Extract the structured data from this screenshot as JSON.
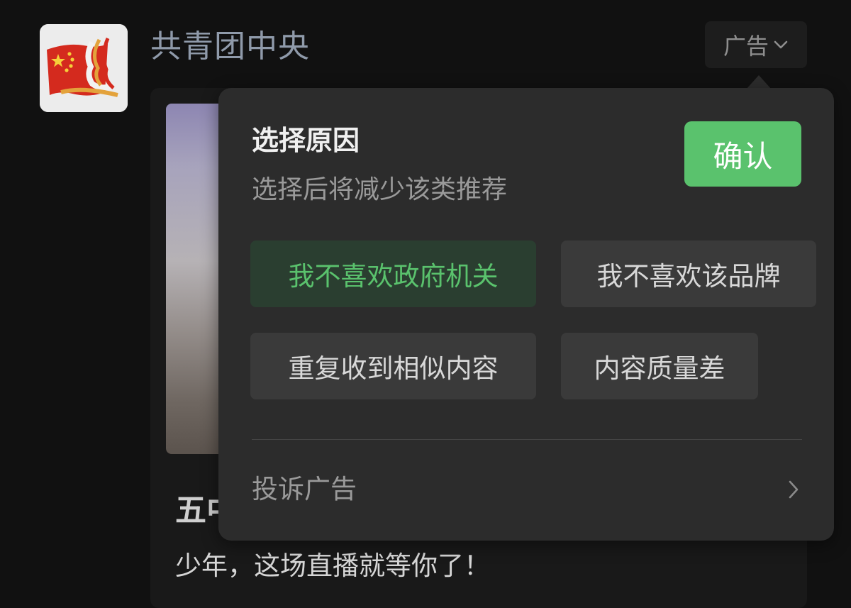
{
  "header": {
    "account_name": "共青团中央",
    "ad_label": "广告"
  },
  "card": {
    "title": "五中",
    "description": "少年，这场直播就等你了！"
  },
  "popup": {
    "title": "选择原因",
    "subtitle": "选择后将减少该类推荐",
    "confirm_label": "确认",
    "reasons": [
      {
        "label": "我不喜欢政府机关",
        "selected": true
      },
      {
        "label": "我不喜欢该品牌",
        "selected": false
      },
      {
        "label": "重复收到相似内容",
        "selected": false
      },
      {
        "label": "内容质量差",
        "selected": false
      }
    ],
    "report_label": "投诉广告"
  },
  "colors": {
    "accent": "#5ac26d",
    "selected_bg": "#2a3e30",
    "popup_bg": "#2c2c2c",
    "page_bg": "#111111"
  },
  "icons": {
    "ad_dropdown": "chevron-down-icon",
    "report_arrow": "chevron-right-icon",
    "avatar": "flag-logo"
  }
}
